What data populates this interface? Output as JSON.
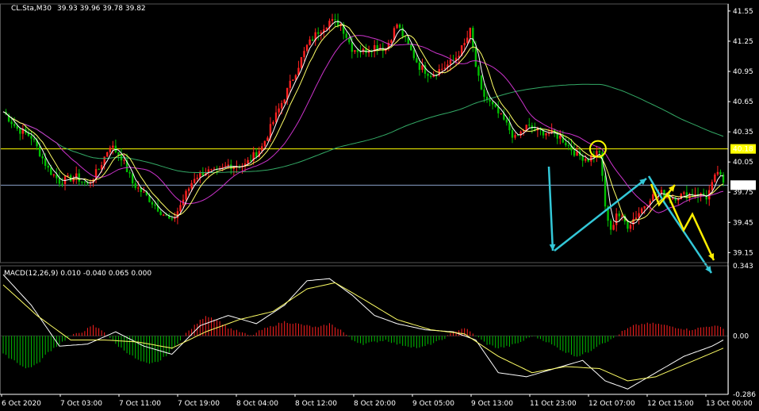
{
  "header": {
    "symbol_label": "CL.Sta,M30",
    "ohlc_label": "39.93 39.96 39.78 39.82",
    "macd_label": "MACD(12,26,9) 0.010 -0.040 0.065 0.000"
  },
  "colors": {
    "background": "#000000",
    "axis": "#ffffff",
    "bull_candle": "#ff2020",
    "bear_candle": "#00c000",
    "ma_fast": "#ffffff",
    "ma_mid": "#ffff66",
    "ma_slow": "#cc33cc",
    "ma_long": "#33aa66",
    "support_line": "#ffff00",
    "price_line": "#8aa0c8",
    "arrow_cyan": "#33c8d8",
    "arrow_yellow": "#ffee00",
    "macd_line": "#ffffff",
    "signal_line": "#ffff66"
  },
  "chart_data": [
    {
      "type": "candlestick",
      "pane": "price",
      "ylim": [
        39.05,
        41.62
      ],
      "y_ticks": [
        "41.55",
        "41.25",
        "40.95",
        "40.65",
        "40.35",
        "40.05",
        "39.75",
        "39.45",
        "39.15"
      ],
      "horizontal_level": {
        "label": "40.18",
        "value": 40.18
      },
      "current_price": {
        "label": "39.82",
        "value": 39.82
      },
      "x_labels": [
        "6 Oct 2020",
        "7 Oct 03:00",
        "7 Oct 11:00",
        "7 Oct 19:00",
        "8 Oct 04:00",
        "8 Oct 12:00",
        "8 Oct 20:00",
        "9 Oct 05:00",
        "9 Oct 13:00",
        "11 Oct 23:00",
        "12 Oct 07:00",
        "12 Oct 15:00",
        "13 Oct 00:00"
      ],
      "close_path": [
        [
          0,
          40.55
        ],
        [
          5,
          40.38
        ],
        [
          10,
          40.3
        ],
        [
          16,
          39.98
        ],
        [
          20,
          39.86
        ],
        [
          26,
          39.9
        ],
        [
          30,
          39.82
        ],
        [
          34,
          39.98
        ],
        [
          38,
          40.22
        ],
        [
          42,
          40.1
        ],
        [
          46,
          39.84
        ],
        [
          52,
          39.68
        ],
        [
          56,
          39.56
        ],
        [
          60,
          39.45
        ],
        [
          64,
          39.68
        ],
        [
          68,
          39.9
        ],
        [
          72,
          39.96
        ],
        [
          76,
          39.94
        ],
        [
          80,
          40.02
        ],
        [
          86,
          40.02
        ],
        [
          92,
          40.2
        ],
        [
          96,
          40.45
        ],
        [
          100,
          40.7
        ],
        [
          104,
          40.95
        ],
        [
          108,
          41.2
        ],
        [
          112,
          41.35
        ],
        [
          116,
          41.45
        ],
        [
          120,
          41.42
        ],
        [
          124,
          41.18
        ],
        [
          128,
          41.15
        ],
        [
          132,
          41.2
        ],
        [
          136,
          41.18
        ],
        [
          140,
          41.42
        ],
        [
          144,
          41.2
        ],
        [
          148,
          41.0
        ],
        [
          152,
          40.92
        ],
        [
          156,
          40.98
        ],
        [
          160,
          41.05
        ],
        [
          164,
          41.22
        ],
        [
          166,
          41.35
        ],
        [
          168,
          41.0
        ],
        [
          170,
          40.74
        ],
        [
          174,
          40.6
        ],
        [
          178,
          40.46
        ],
        [
          182,
          40.28
        ],
        [
          186,
          40.4
        ],
        [
          190,
          40.36
        ],
        [
          194,
          40.34
        ],
        [
          198,
          40.3
        ],
        [
          204,
          40.12
        ],
        [
          208,
          40.08
        ],
        [
          212,
          40.16
        ],
        [
          214,
          39.6
        ],
        [
          216,
          39.35
        ],
        [
          218,
          39.55
        ],
        [
          222,
          39.42
        ],
        [
          226,
          39.55
        ],
        [
          230,
          39.7
        ],
        [
          234,
          39.74
        ],
        [
          238,
          39.7
        ],
        [
          242,
          39.72
        ],
        [
          246,
          39.74
        ],
        [
          250,
          39.7
        ],
        [
          252,
          39.82
        ],
        [
          254,
          39.96
        ],
        [
          256,
          39.82
        ]
      ],
      "macd_histogram_range": [
        -0.286,
        0.343
      ],
      "annotations": [
        "support circle at 40.18",
        "cyan zigzag projection",
        "yellow zigzag projection"
      ]
    },
    {
      "type": "bar",
      "pane": "macd",
      "ylim": [
        -0.286,
        0.343
      ],
      "y_ticks": [
        "0.343",
        "0.00",
        "-0.286"
      ],
      "histogram": [
        [
          0,
          -0.09
        ],
        [
          4,
          -0.12
        ],
        [
          8,
          -0.16
        ],
        [
          12,
          -0.14
        ],
        [
          16,
          -0.08
        ],
        [
          20,
          -0.04
        ],
        [
          24,
          0.0
        ],
        [
          28,
          0.02
        ],
        [
          32,
          0.05
        ],
        [
          36,
          0.02
        ],
        [
          40,
          -0.04
        ],
        [
          44,
          -0.08
        ],
        [
          48,
          -0.12
        ],
        [
          52,
          -0.14
        ],
        [
          56,
          -0.12
        ],
        [
          60,
          -0.07
        ],
        [
          64,
          0.0
        ],
        [
          68,
          0.05
        ],
        [
          72,
          0.1
        ],
        [
          76,
          0.08
        ],
        [
          80,
          0.04
        ],
        [
          84,
          0.02
        ],
        [
          88,
          0.0
        ],
        [
          92,
          0.03
        ],
        [
          96,
          0.05
        ],
        [
          100,
          0.07
        ],
        [
          104,
          0.06
        ],
        [
          108,
          0.05
        ],
        [
          112,
          0.04
        ],
        [
          116,
          0.06
        ],
        [
          120,
          0.03
        ],
        [
          124,
          -0.02
        ],
        [
          128,
          -0.04
        ],
        [
          132,
          -0.03
        ],
        [
          136,
          -0.02
        ],
        [
          140,
          -0.04
        ],
        [
          144,
          -0.05
        ],
        [
          148,
          -0.06
        ],
        [
          152,
          -0.04
        ],
        [
          156,
          -0.02
        ],
        [
          160,
          0.02
        ],
        [
          164,
          0.04
        ],
        [
          168,
          0.0
        ],
        [
          172,
          -0.04
        ],
        [
          176,
          -0.06
        ],
        [
          180,
          -0.05
        ],
        [
          184,
          -0.03
        ],
        [
          188,
          0.0
        ],
        [
          192,
          -0.02
        ],
        [
          196,
          -0.05
        ],
        [
          200,
          -0.08
        ],
        [
          204,
          -0.1
        ],
        [
          208,
          -0.08
        ],
        [
          212,
          -0.04
        ],
        [
          216,
          -0.02
        ],
        [
          220,
          0.02
        ],
        [
          224,
          0.05
        ],
        [
          228,
          0.06
        ],
        [
          232,
          0.06
        ],
        [
          236,
          0.05
        ],
        [
          240,
          0.04
        ],
        [
          244,
          0.03
        ],
        [
          248,
          0.04
        ],
        [
          252,
          0.05
        ],
        [
          256,
          0.04
        ]
      ],
      "macd_line": [
        [
          0,
          0.3
        ],
        [
          10,
          0.15
        ],
        [
          20,
          -0.05
        ],
        [
          30,
          -0.04
        ],
        [
          40,
          0.02
        ],
        [
          50,
          -0.05
        ],
        [
          60,
          -0.09
        ],
        [
          70,
          0.05
        ],
        [
          80,
          0.1
        ],
        [
          90,
          0.06
        ],
        [
          100,
          0.15
        ],
        [
          108,
          0.27
        ],
        [
          116,
          0.28
        ],
        [
          124,
          0.2
        ],
        [
          132,
          0.1
        ],
        [
          140,
          0.06
        ],
        [
          150,
          0.03
        ],
        [
          160,
          0.02
        ],
        [
          168,
          -0.02
        ],
        [
          176,
          -0.18
        ],
        [
          186,
          -0.2
        ],
        [
          196,
          -0.16
        ],
        [
          206,
          -0.12
        ],
        [
          214,
          -0.22
        ],
        [
          222,
          -0.26
        ],
        [
          232,
          -0.18
        ],
        [
          242,
          -0.1
        ],
        [
          252,
          -0.05
        ],
        [
          256,
          -0.02
        ]
      ],
      "signal_line": [
        [
          0,
          0.25
        ],
        [
          12,
          0.1
        ],
        [
          24,
          -0.02
        ],
        [
          36,
          -0.02
        ],
        [
          48,
          -0.03
        ],
        [
          60,
          -0.06
        ],
        [
          72,
          0.02
        ],
        [
          84,
          0.08
        ],
        [
          96,
          0.12
        ],
        [
          108,
          0.23
        ],
        [
          118,
          0.26
        ],
        [
          128,
          0.18
        ],
        [
          140,
          0.08
        ],
        [
          152,
          0.03
        ],
        [
          164,
          0.01
        ],
        [
          176,
          -0.1
        ],
        [
          188,
          -0.18
        ],
        [
          200,
          -0.15
        ],
        [
          212,
          -0.16
        ],
        [
          222,
          -0.22
        ],
        [
          232,
          -0.2
        ],
        [
          244,
          -0.13
        ],
        [
          256,
          -0.06
        ]
      ]
    }
  ]
}
